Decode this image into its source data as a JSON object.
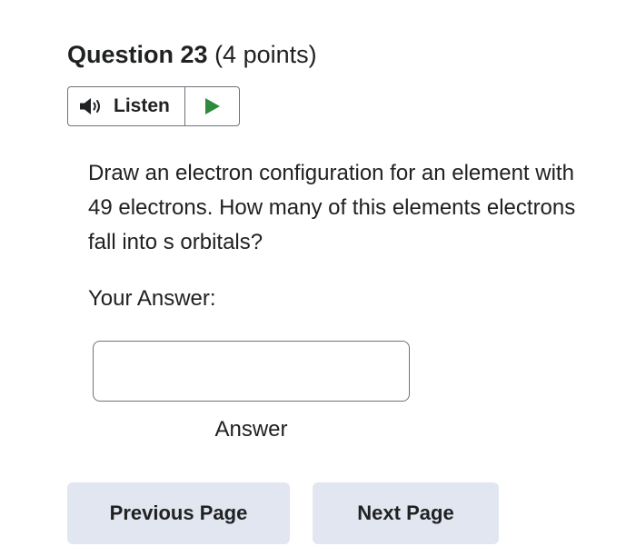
{
  "question": {
    "title": "Question 23",
    "points": "(4 points)"
  },
  "listen": {
    "label": "Listen",
    "speaker_icon": "speaker-icon",
    "play_icon": "play-icon",
    "play_color": "#2e8b3c"
  },
  "question_text": "Draw an electron configuration for an element with 49 electrons. How many of this elements electrons fall into s orbitals?",
  "answer": {
    "label": "Your Answer:",
    "value": "",
    "placeholder": "",
    "caption": "Answer"
  },
  "navigation": {
    "previous_label": "Previous Page",
    "next_label": "Next Page"
  }
}
